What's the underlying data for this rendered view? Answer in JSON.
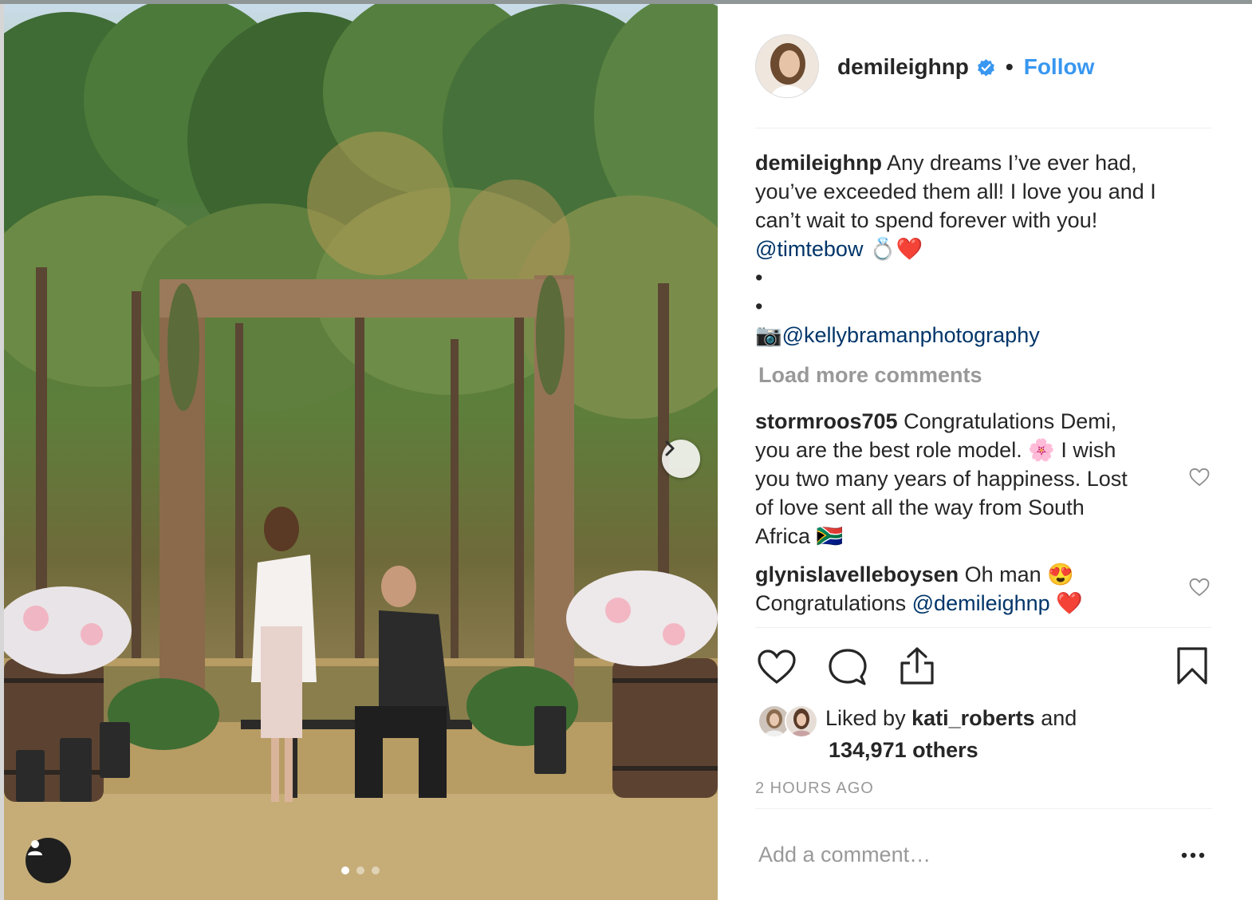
{
  "colors": {
    "link_blue": "#3897f0",
    "mention_blue": "#003569",
    "muted_gray": "#999999",
    "text_dark": "#262626",
    "heart_red": "#ed1c24",
    "divider": "#efefef"
  },
  "photo": {
    "next_icon": "chevron-right-icon",
    "user_tag_icon": "person-icon",
    "carousel_dots": 3,
    "active_dot": 1
  },
  "header": {
    "username": "demileighnp",
    "verified_icon": "verified-badge-icon",
    "separator": "•",
    "follow_label": "Follow"
  },
  "caption": {
    "username": "demileighnp",
    "line1": "Any dreams I’ve ever had,",
    "line2": "you’ve exceeded them all! I love you and I",
    "line3": "can’t wait to spend forever with you!",
    "mention": "@timtebow",
    "mention_emoji": "💍❤️",
    "bullet1": "•",
    "bullet2": "•",
    "camera_emoji": "📷",
    "photo_credit": "@kellybramanphotography"
  },
  "load_more_label": "Load more comments",
  "comments": [
    {
      "username": "stormroos705",
      "lines": [
        "Congratulations Demi,",
        "you are the best role model. 🌸  I wish",
        "you two many years of happiness. Lost",
        "of love sent all the way from South",
        "Africa 🇿🇦"
      ]
    },
    {
      "username": "glynislavelleboysen",
      "line1": "Oh man 😍",
      "line2_prefix": "Congratulations",
      "line2_mention": "@demileighnp",
      "line2_emoji": "❤️"
    }
  ],
  "actions": {
    "like_icon": "heart-icon",
    "comment_icon": "comment-bubble-icon",
    "share_icon": "share-icon",
    "save_icon": "bookmark-icon"
  },
  "likes": {
    "prefix": "Liked by",
    "user": "kati_roberts",
    "and": "and",
    "count_text": "134,971 others"
  },
  "timestamp": "2 HOURS AGO",
  "add_comment": {
    "placeholder": "Add a comment…",
    "more_icon": "more-options-icon"
  }
}
